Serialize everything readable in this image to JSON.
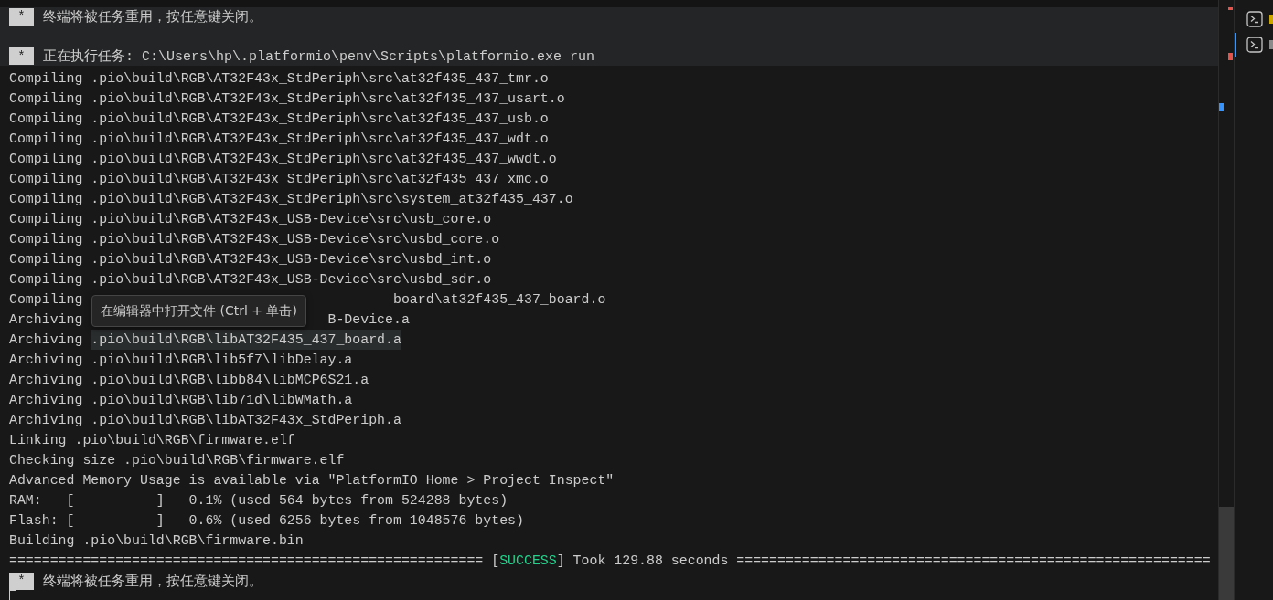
{
  "header": [
    {
      "badge": "*",
      "text": "终端将被任务重用，按任意键关闭。"
    },
    {
      "badge": "*",
      "text": "正在执行任务: C:\\Users\\hp\\.platformio\\penv\\Scripts\\platformio.exe run"
    }
  ],
  "lines": [
    {
      "kind": "step",
      "verb": "Compiling",
      "path": ".pio\\build\\RGB\\AT32F43x_StdPeriph\\src\\at32f435_437_tmr.o",
      "hovered": false
    },
    {
      "kind": "step",
      "verb": "Compiling",
      "path": ".pio\\build\\RGB\\AT32F43x_StdPeriph\\src\\at32f435_437_usart.o",
      "hovered": false
    },
    {
      "kind": "step",
      "verb": "Compiling",
      "path": ".pio\\build\\RGB\\AT32F43x_StdPeriph\\src\\at32f435_437_usb.o",
      "hovered": false
    },
    {
      "kind": "step",
      "verb": "Compiling",
      "path": ".pio\\build\\RGB\\AT32F43x_StdPeriph\\src\\at32f435_437_wdt.o",
      "hovered": false
    },
    {
      "kind": "step",
      "verb": "Compiling",
      "path": ".pio\\build\\RGB\\AT32F43x_StdPeriph\\src\\at32f435_437_wwdt.o",
      "hovered": false
    },
    {
      "kind": "step",
      "verb": "Compiling",
      "path": ".pio\\build\\RGB\\AT32F43x_StdPeriph\\src\\at32f435_437_xmc.o",
      "hovered": false
    },
    {
      "kind": "step",
      "verb": "Compiling",
      "path": ".pio\\build\\RGB\\AT32F43x_StdPeriph\\src\\system_at32f435_437.o",
      "hovered": false
    },
    {
      "kind": "step",
      "verb": "Compiling",
      "path": ".pio\\build\\RGB\\AT32F43x_USB-Device\\src\\usb_core.o",
      "hovered": false
    },
    {
      "kind": "step",
      "verb": "Compiling",
      "path": ".pio\\build\\RGB\\AT32F43x_USB-Device\\src\\usbd_core.o",
      "hovered": false
    },
    {
      "kind": "step",
      "verb": "Compiling",
      "path": ".pio\\build\\RGB\\AT32F43x_USB-Device\\src\\usbd_int.o",
      "hovered": false
    },
    {
      "kind": "step",
      "verb": "Compiling",
      "path": ".pio\\build\\RGB\\AT32F43x_USB-Device\\src\\usbd_sdr.o",
      "hovered": false
    },
    {
      "kind": "covered",
      "segments": [
        "Compiling",
        "board\\at32f435_437_board.o"
      ]
    },
    {
      "kind": "covered",
      "segments": [
        "Archiving",
        "B-Device.a"
      ]
    },
    {
      "kind": "step",
      "verb": "Archiving",
      "path": ".pio\\build\\RGB\\libAT32F435_437_board.a",
      "hovered": true
    },
    {
      "kind": "step",
      "verb": "Archiving",
      "path": ".pio\\build\\RGB\\lib5f7\\libDelay.a",
      "hovered": false
    },
    {
      "kind": "step",
      "verb": "Archiving",
      "path": ".pio\\build\\RGB\\libb84\\libMCP6S21.a",
      "hovered": false
    },
    {
      "kind": "step",
      "verb": "Archiving",
      "path": ".pio\\build\\RGB\\lib71d\\libWMath.a",
      "hovered": false
    },
    {
      "kind": "step",
      "verb": "Archiving",
      "path": ".pio\\build\\RGB\\libAT32F43x_StdPeriph.a",
      "hovered": false
    },
    {
      "kind": "step",
      "verb": "Linking",
      "path": ".pio\\build\\RGB\\firmware.elf",
      "hovered": false
    },
    {
      "kind": "step",
      "verb": "Checking size",
      "path": ".pio\\build\\RGB\\firmware.elf",
      "hovered": false
    },
    {
      "kind": "plain",
      "text": "Advanced Memory Usage is available via \"PlatformIO Home > Project Inspect\""
    },
    {
      "kind": "plain",
      "text": "RAM:   [          ]   0.1% (used 564 bytes from 524288 bytes)"
    },
    {
      "kind": "plain",
      "text": "Flash: [          ]   0.6% (used 6256 bytes from 1048576 bytes)"
    },
    {
      "kind": "step",
      "verb": "Building",
      "path": ".pio\\build\\RGB\\firmware.bin",
      "hovered": false
    },
    {
      "kind": "result",
      "before": "========================================================== [",
      "status": "SUCCESS",
      "after": "] Took 129.88 seconds =========================================================="
    },
    {
      "kind": "task",
      "badge": "*",
      "text": "终端将被任务重用，按任意键关闭。"
    }
  ],
  "tooltip": {
    "text": "在编辑器中打开文件 (Ctrl + 单击)"
  },
  "terminals": [
    {
      "color": "#cca700"
    },
    {
      "color": "#8b8b8b"
    }
  ]
}
